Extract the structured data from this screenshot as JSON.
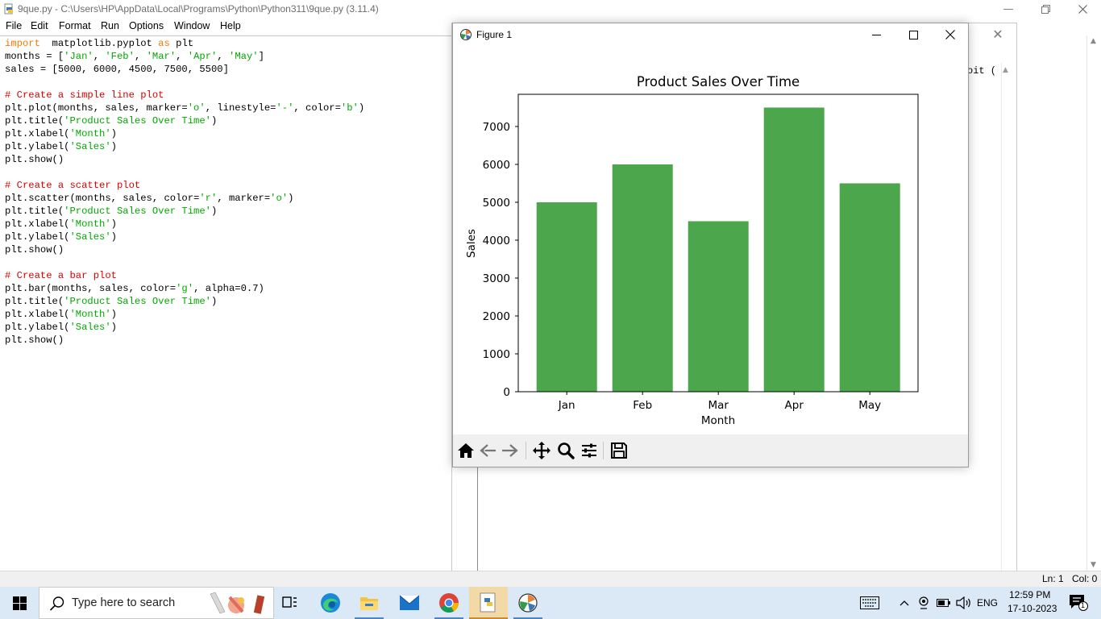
{
  "idle": {
    "title": "9que.py - C:\\Users\\HP\\AppData\\Local\\Programs\\Python\\Python311\\9que.py (3.11.4)",
    "menu": [
      "File",
      "Edit",
      "Format",
      "Run",
      "Options",
      "Window",
      "Help"
    ],
    "code": [
      [
        [
          "kw",
          "import"
        ],
        [
          "",
          "  matplotlib.pyplot "
        ],
        [
          "kw",
          "as"
        ],
        [
          "",
          " plt"
        ]
      ],
      [
        [
          "",
          "months = ["
        ],
        [
          "str",
          "'Jan'"
        ],
        [
          "",
          ", "
        ],
        [
          "str",
          "'Feb'"
        ],
        [
          "",
          ", "
        ],
        [
          "str",
          "'Mar'"
        ],
        [
          "",
          ", "
        ],
        [
          "str",
          "'Apr'"
        ],
        [
          "",
          ", "
        ],
        [
          "str",
          "'May'"
        ],
        [
          "",
          "]"
        ]
      ],
      [
        [
          "",
          "sales = [5000, 6000, 4500, 7500, 5500]"
        ]
      ],
      [],
      [
        [
          "cmt",
          "# Create a simple line plot"
        ]
      ],
      [
        [
          "",
          "plt.plot(months, sales, marker="
        ],
        [
          "str",
          "'o'"
        ],
        [
          "",
          ", linestyle="
        ],
        [
          "str",
          "'-'"
        ],
        [
          "",
          ", color="
        ],
        [
          "str",
          "'b'"
        ],
        [
          "",
          ")"
        ]
      ],
      [
        [
          "",
          "plt.title("
        ],
        [
          "str",
          "'Product Sales Over Time'"
        ],
        [
          "",
          ")"
        ]
      ],
      [
        [
          "",
          "plt.xlabel("
        ],
        [
          "str",
          "'Month'"
        ],
        [
          "",
          ")"
        ]
      ],
      [
        [
          "",
          "plt.ylabel("
        ],
        [
          "str",
          "'Sales'"
        ],
        [
          "",
          ")"
        ]
      ],
      [
        [
          "",
          "plt.show()"
        ]
      ],
      [],
      [
        [
          "cmt",
          "# Create a scatter plot"
        ]
      ],
      [
        [
          "",
          "plt.scatter(months, sales, color="
        ],
        [
          "str",
          "'r'"
        ],
        [
          "",
          ", marker="
        ],
        [
          "str",
          "'o'"
        ],
        [
          "",
          ")"
        ]
      ],
      [
        [
          "",
          "plt.title("
        ],
        [
          "str",
          "'Product Sales Over Time'"
        ],
        [
          "",
          ")"
        ]
      ],
      [
        [
          "",
          "plt.xlabel("
        ],
        [
          "str",
          "'Month'"
        ],
        [
          "",
          ")"
        ]
      ],
      [
        [
          "",
          "plt.ylabel("
        ],
        [
          "str",
          "'Sales'"
        ],
        [
          "",
          ")"
        ]
      ],
      [
        [
          "",
          "plt.show()"
        ]
      ],
      [],
      [
        [
          "cmt",
          "# Create a bar plot"
        ]
      ],
      [
        [
          "",
          "plt.bar(months, sales, color="
        ],
        [
          "str",
          "'g'"
        ],
        [
          "",
          ", alpha=0.7)"
        ]
      ],
      [
        [
          "",
          "plt.title("
        ],
        [
          "str",
          "'Product Sales Over Time'"
        ],
        [
          "",
          ")"
        ]
      ],
      [
        [
          "",
          "plt.xlabel("
        ],
        [
          "str",
          "'Month'"
        ],
        [
          "",
          ")"
        ]
      ],
      [
        [
          "",
          "plt.ylabel("
        ],
        [
          "str",
          "'Sales'"
        ],
        [
          "",
          ")"
        ]
      ],
      [
        [
          "",
          "plt.show()"
        ]
      ]
    ],
    "status_ln": "Ln: 1",
    "status_col": "Col: 0",
    "background_partial_text": "oit ("
  },
  "figure": {
    "window_title": "Figure 1",
    "toolbar_icons": [
      "home-icon",
      "back-icon",
      "forward-icon",
      "pan-icon",
      "zoom-icon",
      "configure-subplots-icon",
      "save-icon"
    ]
  },
  "chart_data": {
    "type": "bar",
    "title": "Product Sales Over Time",
    "xlabel": "Month",
    "ylabel": "Sales",
    "categories": [
      "Jan",
      "Feb",
      "Mar",
      "Apr",
      "May"
    ],
    "values": [
      5000,
      6000,
      4500,
      7500,
      5500
    ],
    "ylim": [
      0,
      7850
    ],
    "yticks": [
      0,
      1000,
      2000,
      3000,
      4000,
      5000,
      6000,
      7000
    ],
    "bar_color": "#4ca64c",
    "grid": false
  },
  "taskbar": {
    "search_placeholder": "Type here to search",
    "apps": [
      "task-view-icon",
      "edge-icon",
      "file-explorer-icon",
      "mail-icon",
      "chrome-icon",
      "python-idle-icon",
      "matplotlib-figure-icon"
    ],
    "language": "ENG",
    "time": "12:59 PM",
    "date": "17-10-2023",
    "notification_count": "1"
  }
}
